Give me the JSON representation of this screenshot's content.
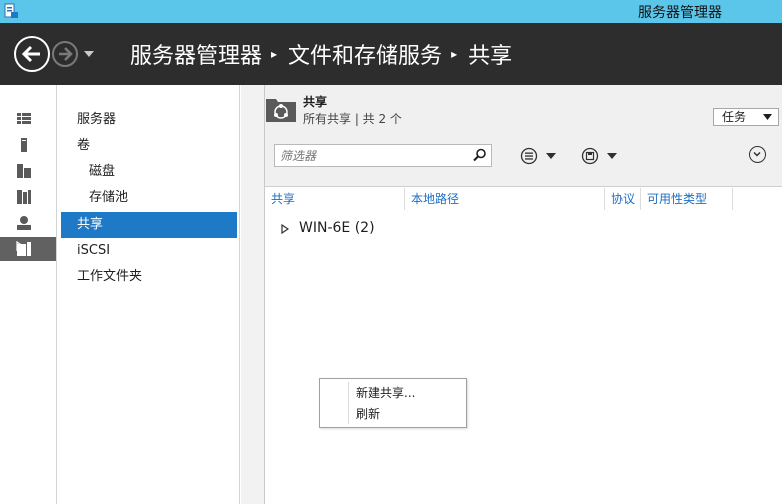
{
  "window": {
    "title": "服务器管理器",
    "app_icon": "server-manager-icon"
  },
  "header": {
    "breadcrumb": [
      "服务器管理器",
      "文件和存储服务",
      "共享"
    ],
    "back_icon": "back-arrow-icon",
    "forward_icon": "forward-arrow-icon"
  },
  "rail": {
    "items": [
      {
        "icon": "dashboard-icon"
      },
      {
        "icon": "local-server-icon"
      },
      {
        "icon": "all-servers-icon"
      },
      {
        "icon": "file-storage-icon"
      },
      {
        "icon": "iis-icon"
      },
      {
        "icon": "file-storage-services-icon",
        "selected": true
      }
    ]
  },
  "nav": {
    "items": [
      {
        "label": "服务器",
        "level": 0,
        "selected": false
      },
      {
        "label": "卷",
        "level": 0,
        "selected": false
      },
      {
        "label": "磁盘",
        "level": 1,
        "selected": false
      },
      {
        "label": "存储池",
        "level": 1,
        "selected": false
      },
      {
        "label": "共享",
        "level": 0,
        "selected": true
      },
      {
        "label": "iSCSI",
        "level": 0,
        "selected": false
      },
      {
        "label": "工作文件夹",
        "level": 0,
        "selected": false
      }
    ]
  },
  "tile": {
    "title": "共享",
    "subtitle": "所有共享 | 共 2 个",
    "tasks_label": "任务",
    "filter": {
      "placeholder": "筛选器",
      "value": ""
    },
    "columns": [
      "共享",
      "本地路径",
      "协议",
      "可用性类型"
    ],
    "groups": [
      {
        "label": "WIN-6E (2)",
        "expanded": false
      }
    ]
  },
  "context_menu": {
    "items": [
      "新建共享...",
      "刷新"
    ]
  },
  "colors": {
    "titlebar": "#5bc6ea",
    "header": "#2d2d2d",
    "selection": "#1e7ac6",
    "rail_selected": "#616161",
    "column_link": "#1e6ec2"
  }
}
